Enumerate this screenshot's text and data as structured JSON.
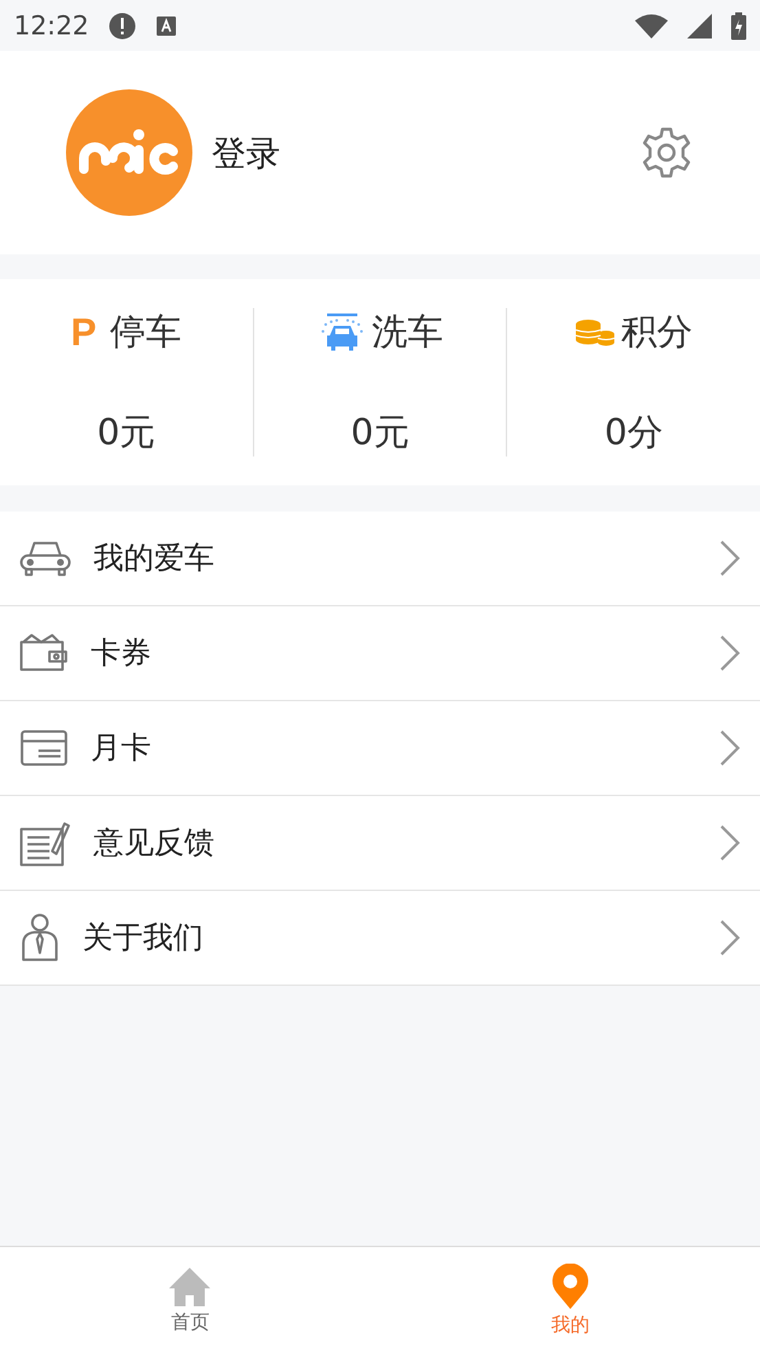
{
  "status_bar": {
    "time": "12:22"
  },
  "profile": {
    "login_label": "登录"
  },
  "stats": [
    {
      "kind": "parking",
      "badge": "P",
      "title": "停车",
      "value": "0元"
    },
    {
      "kind": "wash",
      "title": "洗车",
      "value": "0元"
    },
    {
      "kind": "points",
      "title": "积分",
      "value": "0分"
    }
  ],
  "menu": [
    {
      "kind": "car",
      "label": "我的爱车"
    },
    {
      "kind": "wallet",
      "label": "卡券"
    },
    {
      "kind": "card",
      "label": "月卡"
    },
    {
      "kind": "feedback",
      "label": "意见反馈"
    },
    {
      "kind": "about",
      "label": "关于我们"
    }
  ],
  "tab_bar": [
    {
      "kind": "home",
      "label": "首页",
      "selected": false
    },
    {
      "kind": "mine",
      "label": "我的",
      "selected": true
    }
  ]
}
